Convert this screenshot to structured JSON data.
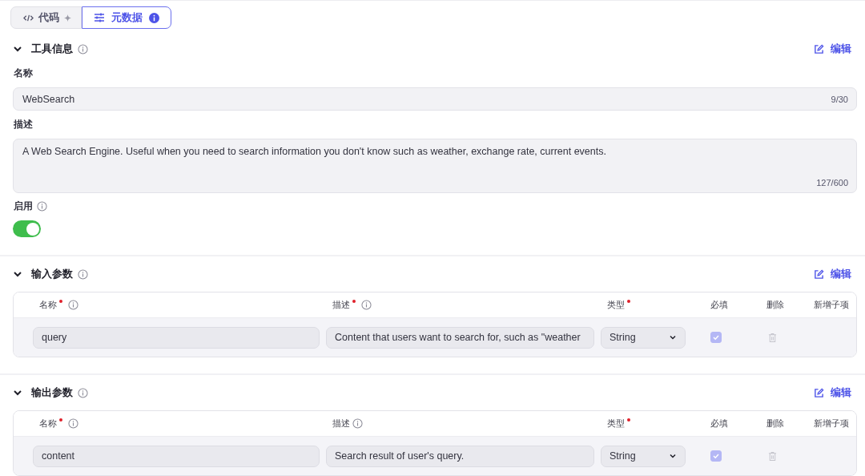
{
  "tabs": [
    {
      "label": "代码",
      "selected": false
    },
    {
      "label": "元数据",
      "selected": true
    }
  ],
  "tool_info": {
    "title": "工具信息",
    "expanded": true,
    "edit": "编辑",
    "name": {
      "label": "名称",
      "value": "WebSearch",
      "count": "9/30"
    },
    "description": {
      "label": "描述",
      "value": "A Web Search Engine. Useful when you need to search information you don't know such as weather, exchange rate, current events.",
      "count": "127/600"
    },
    "enabled": {
      "label": "启用",
      "on": true
    }
  },
  "sections": [
    {
      "title": "输入参数",
      "expanded": true,
      "edit": "编辑",
      "columns": [
        {
          "label": "名称",
          "required": true,
          "info": true
        },
        {
          "label": "描述",
          "required": true,
          "info": true
        },
        {
          "label": "类型",
          "required": true,
          "info": false
        },
        {
          "label": "必填",
          "required": false,
          "info": false
        },
        {
          "label": "删除",
          "required": false,
          "info": false
        },
        {
          "label": "新增子项",
          "required": false,
          "info": false
        }
      ],
      "rows": [
        {
          "name": "query",
          "description": "Content that users want to search for, such as \"weather",
          "type": "String",
          "required": true,
          "delete_disabled": true
        }
      ]
    },
    {
      "title": "输出参数",
      "expanded": true,
      "edit": "编辑",
      "columns": [
        {
          "label": "名称",
          "required": true,
          "info": true
        },
        {
          "label": "描述",
          "required": false,
          "info": true
        },
        {
          "label": "类型",
          "required": true,
          "info": false
        },
        {
          "label": "必填",
          "required": false,
          "info": false
        },
        {
          "label": "删除",
          "required": false,
          "info": false
        },
        {
          "label": "新增子项",
          "required": false,
          "info": false
        }
      ],
      "rows": [
        {
          "name": "content",
          "description": "Search result of user's query.",
          "type": "String",
          "required": true,
          "delete_disabled": true
        }
      ]
    }
  ]
}
